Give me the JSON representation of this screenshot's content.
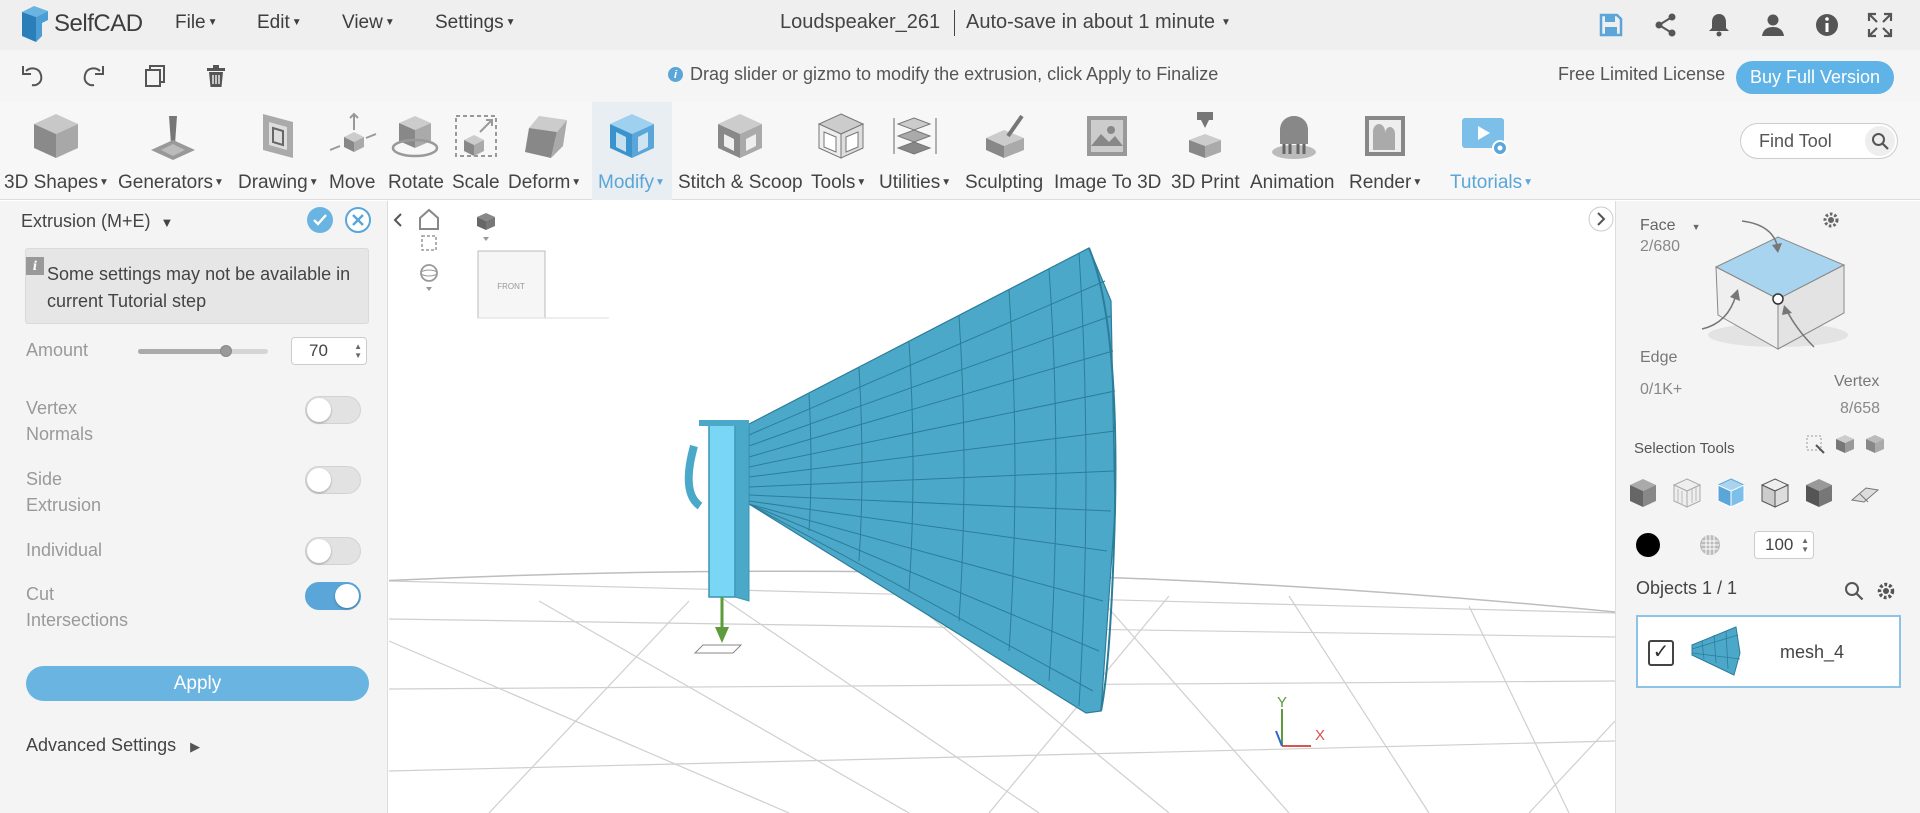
{
  "app": {
    "brand": "SelfCAD"
  },
  "menu": {
    "file": "File",
    "edit": "Edit",
    "view": "View",
    "settings": "Settings"
  },
  "project": {
    "title": "Loudspeaker_261",
    "autosave": "Auto-save in about 1 minute"
  },
  "top_icons": [
    "save-icon",
    "share-icon",
    "bell-icon",
    "user-icon",
    "info-icon",
    "fullscreen-icon"
  ],
  "bar2": {
    "hint": "Drag slider or gizmo to modify the extrusion, click Apply to Finalize",
    "license": "Free Limited License",
    "buy_label": "Buy Full Version"
  },
  "tools": {
    "shapes": "3D Shapes",
    "generators": "Generators",
    "drawing": "Drawing",
    "move": "Move",
    "rotate": "Rotate",
    "scale": "Scale",
    "deform": "Deform",
    "modify": "Modify",
    "stitch": "Stitch & Scoop",
    "tools": "Tools",
    "utilities": "Utilities",
    "sculpting": "Sculpting",
    "image3d": "Image To 3D",
    "print": "3D Print",
    "animation": "Animation",
    "render": "Render",
    "tutorials": "Tutorials",
    "find_placeholder": "Find Tool"
  },
  "left_panel": {
    "title": "Extrusion (M+E)",
    "notice": "Some settings may not be available in current Tutorial step",
    "amount_label": "Amount",
    "amount_value": "70",
    "amount_fraction": 0.68,
    "vertex_normals": {
      "label_1": "Vertex",
      "label_2": "Normals",
      "on": false
    },
    "side_extrusion": {
      "label_1": "Side",
      "label_2": "Extrusion",
      "on": false
    },
    "individual": {
      "label": "Individual",
      "on": false
    },
    "cut_intersections": {
      "label_1": "Cut",
      "label_2": "Intersections",
      "on": true
    },
    "apply_label": "Apply",
    "advanced_label": "Advanced Settings"
  },
  "viewport": {
    "cube_label": "FRONT",
    "axis_y": "Y",
    "axis_x": "X"
  },
  "right_panel": {
    "face_label": "Face",
    "face_count": "2/680",
    "edge_label": "Edge",
    "edge_count": "0/1K+",
    "vertex_label": "Vertex",
    "vertex_count": "8/658",
    "selection_tools_label": "Selection Tools",
    "opacity_value": "100",
    "objects_label": "Objects 1 / 1",
    "object_name": "mesh_4"
  },
  "colors": {
    "accent": "#5aa6d8",
    "mesh": "#5bb8d8",
    "button": "#6ab4e2"
  }
}
